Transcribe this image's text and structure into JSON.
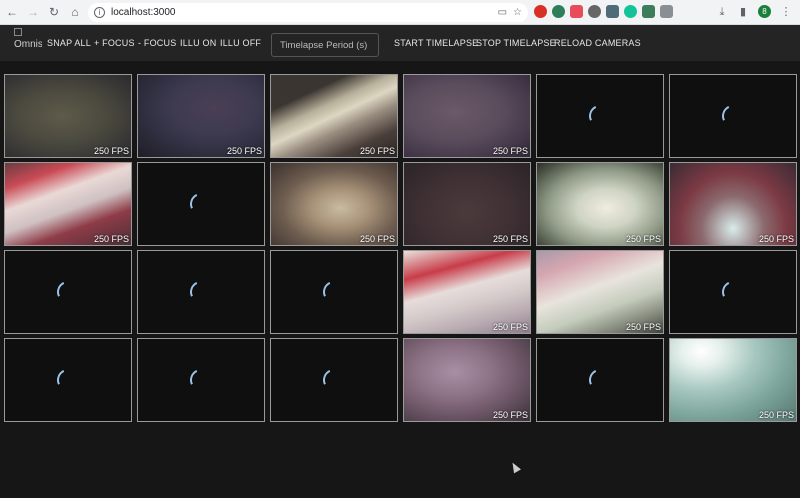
{
  "browser": {
    "url": "localhost:3000"
  },
  "toolbar": {
    "logo_alt": "Omnisc",
    "buttons": [
      "SNAP ALL",
      "+ FOCUS",
      "- FOCUS",
      "ILLU ON",
      "ILLU OFF"
    ],
    "timelapse_placeholder": "Timelapse Period (s)",
    "right_buttons": [
      "START TIMELAPSE",
      "STOP TIMELAPSE",
      "RELOAD CAMERAS"
    ]
  },
  "cameras": [
    {
      "state": "stream",
      "fps": "250 FPS",
      "bg": "radial-gradient(ellipse at 45% 50%, #5f5a4a 0%, #4b4a3f 45%, #3a3836 75%, #2b2a2c 100%)"
    },
    {
      "state": "stream",
      "fps": "250 FPS",
      "bg": "radial-gradient(ellipse at 60% 40%, #4a3f55 0%, #3d3a50 40%, #2d2c3c 70%, #1f1e26 100%)"
    },
    {
      "state": "stream",
      "fps": "250 FPS",
      "bg": "linear-gradient(155deg, #3b3532 0%, #3b3532 25%, #b7b09a 40%, #ddd6c2 50%, #9a8d80 62%, #4a3f3a 80%, #2a2523 100%)"
    },
    {
      "state": "stream",
      "fps": "250 FPS",
      "bg": "radial-gradient(ellipse at 40% 45%, #6b5a68 0%, #5a4c5c 45%, #44384a 75%, #2e2834 100%)"
    },
    {
      "state": "loading",
      "fps": "",
      "bg": "#0f0f0f"
    },
    {
      "state": "loading",
      "fps": "",
      "bg": "#0f0f0f"
    },
    {
      "state": "stream",
      "fps": "250 FPS",
      "bg": "linear-gradient(160deg, #6a3c40 0%, #c94a55 20%, #e9d9d6 38%, #cfc0c2 55%, #8e3c47 72%, #4a2f38 100%)"
    },
    {
      "state": "loading",
      "fps": "",
      "bg": "#0f0f0f"
    },
    {
      "state": "stream",
      "fps": "250 FPS",
      "bg": "radial-gradient(ellipse at 55% 55%, #c9bba0 0%, #a69177 30%, #6d5c4f 60%, #3a302c 100%)"
    },
    {
      "state": "stream",
      "fps": "250 FPS",
      "bg": "radial-gradient(ellipse at 50% 60%, #4c3a3b 0%, #3f3034 50%, #2b2428 100%)"
    },
    {
      "state": "stream",
      "fps": "250 FPS",
      "bg": "radial-gradient(ellipse at 55% 55%, #f0ece0 0%, #cfd4c3 30%, #8f9a86 60%, #4d5446 85%, #2c2f2a 100%)"
    },
    {
      "state": "stream",
      "fps": "250 FPS",
      "bg": "radial-gradient(ellipse at 50% 80%, #d8ecea 0%, #8b6a6e 35%, #7c3a44 60%, #3b2b34 100%)"
    },
    {
      "state": "loading",
      "fps": "",
      "bg": "#0f0f0f"
    },
    {
      "state": "loading",
      "fps": "",
      "bg": "#0f0f0f"
    },
    {
      "state": "loading",
      "fps": "",
      "bg": "#0f0f0f"
    },
    {
      "state": "stream",
      "fps": "250 FPS",
      "bg": "linear-gradient(165deg, #e8e2dc 0%, #c83c49 25%, #e6dddb 45%, #d4c9c9 62%, #b8aab0 80%, #8f7e90 100%)"
    },
    {
      "state": "stream",
      "fps": "250 FPS",
      "bg": "linear-gradient(160deg, #a89aa9 0%, #d6a6b0 20%, #e8e4dd 45%, #c4ccbc 65%, #7d8275 85%, #3f4340 100%)"
    },
    {
      "state": "loading",
      "fps": "",
      "bg": "#0f0f0f"
    },
    {
      "state": "loading",
      "fps": "",
      "bg": "#0f0f0f"
    },
    {
      "state": "loading",
      "fps": "",
      "bg": "#0f0f0f"
    },
    {
      "state": "loading",
      "fps": "",
      "bg": "#0f0f0f"
    },
    {
      "state": "stream",
      "fps": "250 FPS",
      "bg": "radial-gradient(ellipse at 40% 40%, #a98fa5 0%, #8d7385 35%, #6a5464 65%, #3a3038 100%)"
    },
    {
      "state": "loading",
      "fps": "",
      "bg": "#0f0f0f"
    },
    {
      "state": "stream",
      "fps": "250 FPS",
      "bg": "radial-gradient(ellipse at 25% 15%, #ffffff 0%, #e6f0ec 15%, #a6c7bf 40%, #7ea69c 65%, #55776f 100%)"
    }
  ]
}
